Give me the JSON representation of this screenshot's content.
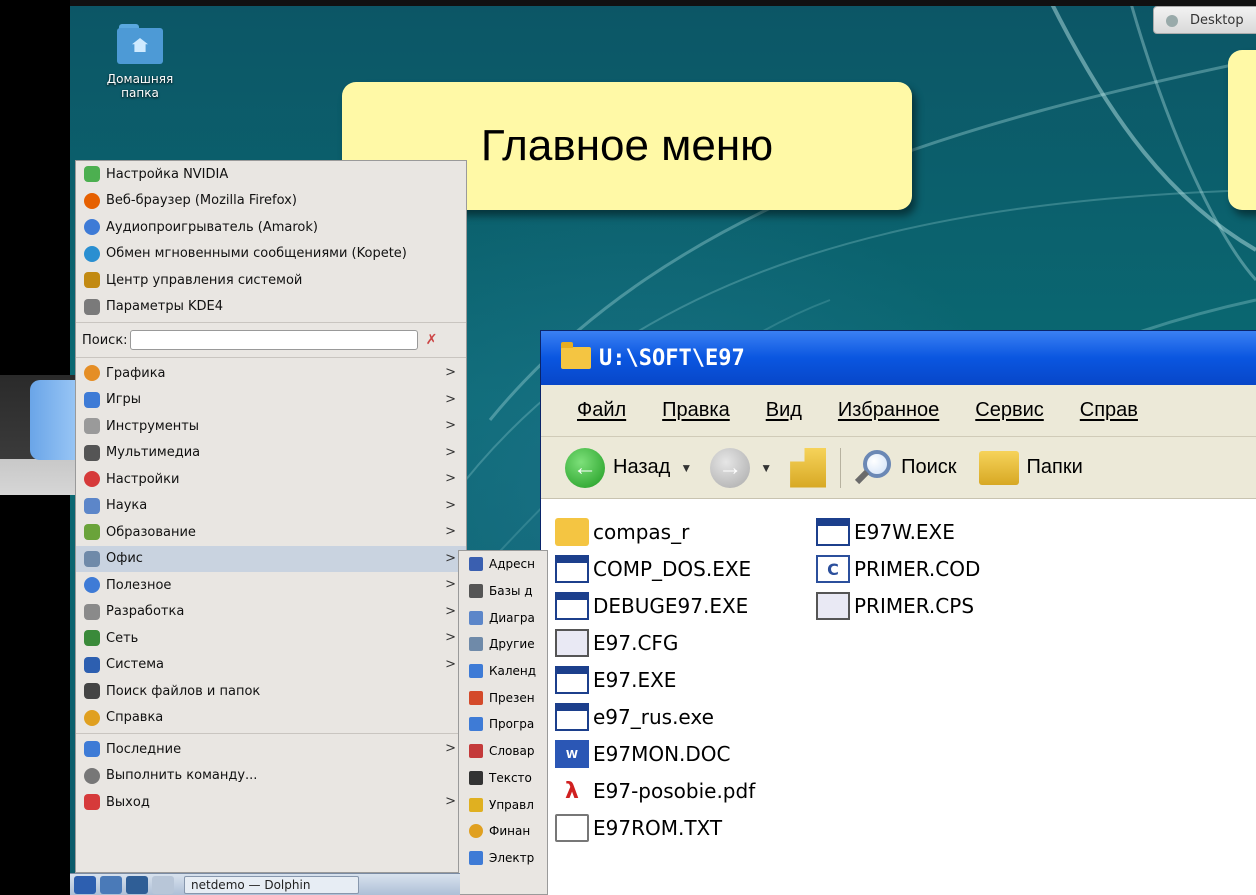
{
  "desktop": {
    "icon_home_label_1": "Домашняя",
    "icon_home_label_2": "папка",
    "desktop_button": "Desktop"
  },
  "callout_main": "Главное меню",
  "kde_menu": {
    "favorites": [
      {
        "label": "Настройка NVIDIA",
        "icon": "nvidia-icon",
        "color": "#4caf50"
      },
      {
        "label": "Веб-браузер (Mozilla Firefox)",
        "icon": "firefox-icon",
        "color": "#e66000"
      },
      {
        "label": "Аудиопроигрыватель (Amarok)",
        "icon": "amarok-icon",
        "color": "#3e7bd6"
      },
      {
        "label": "Обмен мгновенными сообщениями (Kopete)",
        "icon": "kopete-icon",
        "color": "#2a8fd1"
      },
      {
        "label": "Центр управления системой",
        "icon": "control-center-icon",
        "color": "#c28a12"
      },
      {
        "label": "Параметры KDE4",
        "icon": "kde-settings-icon",
        "color": "#7a7a7a"
      }
    ],
    "search_label": "Поиск:",
    "search_value": "",
    "categories": [
      {
        "label": "Графика",
        "icon": "graphics-icon",
        "color": "#e58e25"
      },
      {
        "label": "Игры",
        "icon": "games-icon",
        "color": "#3e7bd6"
      },
      {
        "label": "Инструменты",
        "icon": "tools-icon",
        "color": "#9a9a9a"
      },
      {
        "label": "Мультимедиа",
        "icon": "multimedia-icon",
        "color": "#555555"
      },
      {
        "label": "Настройки",
        "icon": "settings-icon",
        "color": "#d63a3a"
      },
      {
        "label": "Наука",
        "icon": "science-icon",
        "color": "#5c86c9"
      },
      {
        "label": "Образование",
        "icon": "education-icon",
        "color": "#6aa33a"
      },
      {
        "label": "Офис",
        "icon": "office-icon",
        "color": "#6f8aa9"
      },
      {
        "label": "Полезное",
        "icon": "utilities-icon",
        "color": "#3e7bd6"
      },
      {
        "label": "Разработка",
        "icon": "development-icon",
        "color": "#8a8a8a"
      },
      {
        "label": "Сеть",
        "icon": "network-icon",
        "color": "#3a8a3a"
      },
      {
        "label": "Система",
        "icon": "system-icon",
        "color": "#2d5fb0"
      },
      {
        "label": "Поиск файлов и папок",
        "icon": "find-files-icon",
        "color": "#444444"
      },
      {
        "label": "Справка",
        "icon": "help-icon",
        "color": "#e0a020"
      }
    ],
    "bottom": [
      {
        "label": "Последние",
        "icon": "recent-icon",
        "color": "#3e7bd6"
      },
      {
        "label": "Выполнить команду...",
        "icon": "run-command-icon",
        "color": "#777777"
      },
      {
        "label": "Выход",
        "icon": "logout-icon",
        "color": "#d63a3a"
      }
    ],
    "arrow": ">"
  },
  "submenu": {
    "items": [
      {
        "label": "Адресн",
        "icon": "address-book-icon",
        "color": "#3a5fb0"
      },
      {
        "label": "Базы д",
        "icon": "database-icon",
        "color": "#555555"
      },
      {
        "label": "Диагра",
        "icon": "diagram-icon",
        "color": "#5c86c9"
      },
      {
        "label": "Другие",
        "icon": "other-apps-icon",
        "color": "#6f8aa9"
      },
      {
        "label": "Календ",
        "icon": "calendar-icon",
        "color": "#3e7bd6"
      },
      {
        "label": "Презен",
        "icon": "presentation-icon",
        "color": "#d44a2a"
      },
      {
        "label": "Програ",
        "icon": "program-icon",
        "color": "#3e7bd6"
      },
      {
        "label": "Словар",
        "icon": "dictionary-icon",
        "color": "#c43a3a"
      },
      {
        "label": "Тексто",
        "icon": "text-editor-icon",
        "color": "#333333"
      },
      {
        "label": "Управл",
        "icon": "manage-icon",
        "color": "#e0b020"
      },
      {
        "label": "Финан",
        "icon": "finance-icon",
        "color": "#e0a020"
      },
      {
        "label": "Электр",
        "icon": "spreadsheet-icon",
        "color": "#3e7bd6"
      }
    ]
  },
  "taskbar": {
    "task_label": "netdemo — Dolphin"
  },
  "explorer": {
    "title": "U:\\SOFT\\E97",
    "menu": [
      "Файл",
      "Правка",
      "Вид",
      "Избранное",
      "Сервис",
      "Справ"
    ],
    "toolbar": {
      "back": "Назад",
      "search": "Поиск",
      "folders": "Папки"
    },
    "files_col1": [
      {
        "name": "compas_r",
        "icon": "folder-icon",
        "type": "folder"
      },
      {
        "name": "COMP_DOS.EXE",
        "icon": "exe-icon",
        "type": "exe"
      },
      {
        "name": "DEBUGE97.EXE",
        "icon": "exe-icon",
        "type": "exe"
      },
      {
        "name": "E97.CFG",
        "icon": "cfg-icon",
        "type": "cfg"
      },
      {
        "name": "E97.EXE",
        "icon": "exe-icon",
        "type": "exe"
      },
      {
        "name": "e97_rus.exe",
        "icon": "exe-icon",
        "type": "exe"
      },
      {
        "name": "E97MON.DOC",
        "icon": "word-doc-icon",
        "type": "doc"
      },
      {
        "name": "E97-posobie.pdf",
        "icon": "pdf-icon",
        "type": "pdf"
      },
      {
        "name": "E97ROM.TXT",
        "icon": "text-file-icon",
        "type": "txt"
      }
    ],
    "files_col2": [
      {
        "name": "E97W.EXE",
        "icon": "exe-icon",
        "type": "exe"
      },
      {
        "name": "PRIMER.COD",
        "icon": "cod-icon",
        "type": "cod"
      },
      {
        "name": "PRIMER.CPS",
        "icon": "cfg-icon",
        "type": "cfg"
      }
    ]
  }
}
